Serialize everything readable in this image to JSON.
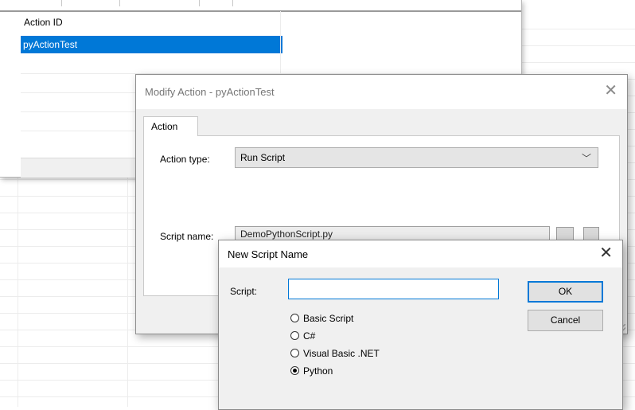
{
  "list_window": {
    "column_header": "Action ID",
    "selected_row": "pyActionTest"
  },
  "modify_dialog": {
    "title": "Modify Action - pyActionTest",
    "close_glyph": "✕",
    "tab_label": "Action",
    "action_type_label": "Action type:",
    "action_type_value": "Run Script",
    "dropdown_glyph": "﹀",
    "script_name_label": "Script name:",
    "script_name_value": "DemoPythonScript.py"
  },
  "new_script_dialog": {
    "title": "New Script Name",
    "close_glyph": "✕",
    "script_label": "Script:",
    "script_value": "",
    "ok_label": "OK",
    "cancel_label": "Cancel",
    "options": [
      {
        "label": "Basic Script",
        "selected": false
      },
      {
        "label": "C#",
        "selected": false
      },
      {
        "label": "Visual Basic .NET",
        "selected": false
      },
      {
        "label": "Python",
        "selected": true
      }
    ]
  },
  "colors": {
    "selection": "#0078d7",
    "dialog_bg": "#f0f0f0"
  }
}
